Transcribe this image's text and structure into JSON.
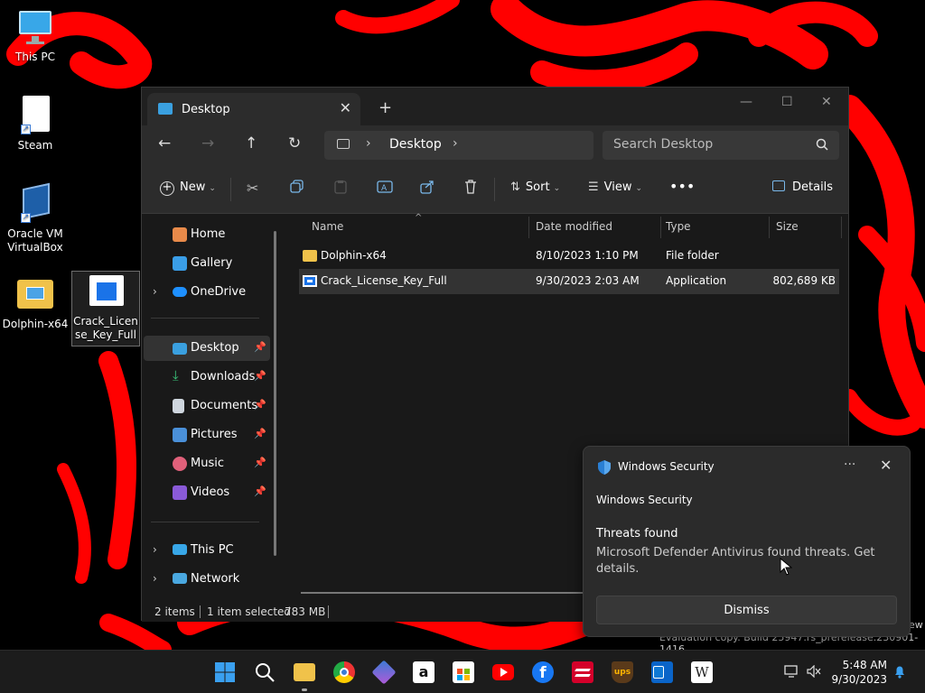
{
  "desktop": {
    "icons": [
      {
        "label": "This PC"
      },
      {
        "label": "Steam"
      },
      {
        "label": "Oracle VM VirtualBox"
      },
      {
        "label": "Dolphin-x64"
      },
      {
        "label": "Crack_License_Key_Full"
      }
    ]
  },
  "explorer": {
    "tab_title": "Desktop",
    "address_crumb": "Desktop",
    "search_placeholder": "Search Desktop",
    "commands": {
      "new_label": "New",
      "sort_label": "Sort",
      "view_label": "View",
      "details_label": "Details"
    },
    "sidebar": {
      "items": [
        {
          "label": "Home"
        },
        {
          "label": "Gallery"
        },
        {
          "label": "OneDrive"
        },
        {
          "label": "Desktop"
        },
        {
          "label": "Downloads"
        },
        {
          "label": "Documents"
        },
        {
          "label": "Pictures"
        },
        {
          "label": "Music"
        },
        {
          "label": "Videos"
        },
        {
          "label": "This PC"
        },
        {
          "label": "Network"
        }
      ]
    },
    "columns": {
      "name": "Name",
      "date": "Date modified",
      "type": "Type",
      "size": "Size"
    },
    "files": [
      {
        "name": "Dolphin-x64",
        "date": "8/10/2023 1:10 PM",
        "type": "File folder",
        "size": ""
      },
      {
        "name": "Crack_License_Key_Full",
        "date": "9/30/2023 2:03 AM",
        "type": "Application",
        "size": "802,689 KB"
      }
    ],
    "status": {
      "item_count": "2 items",
      "selection": "1 item selected",
      "selection_size": "783 MB"
    }
  },
  "toast": {
    "app_name": "Windows Security",
    "source": "Windows Security",
    "title": "Threats found",
    "body": "Microsoft Defender Antivirus found threats. Get details.",
    "dismiss_label": "Dismiss"
  },
  "watermark": {
    "line1_tail": "ew",
    "line2": "Evaluation copy. Build 25947.rs_prerelease.230901-1416"
  },
  "taskbar": {
    "time": "5:48 AM",
    "date": "9/30/2023"
  },
  "colors": {
    "wallpaper_red": "#ff0000",
    "accent_blue": "#3aa0e0",
    "window_bg": "#191919"
  }
}
